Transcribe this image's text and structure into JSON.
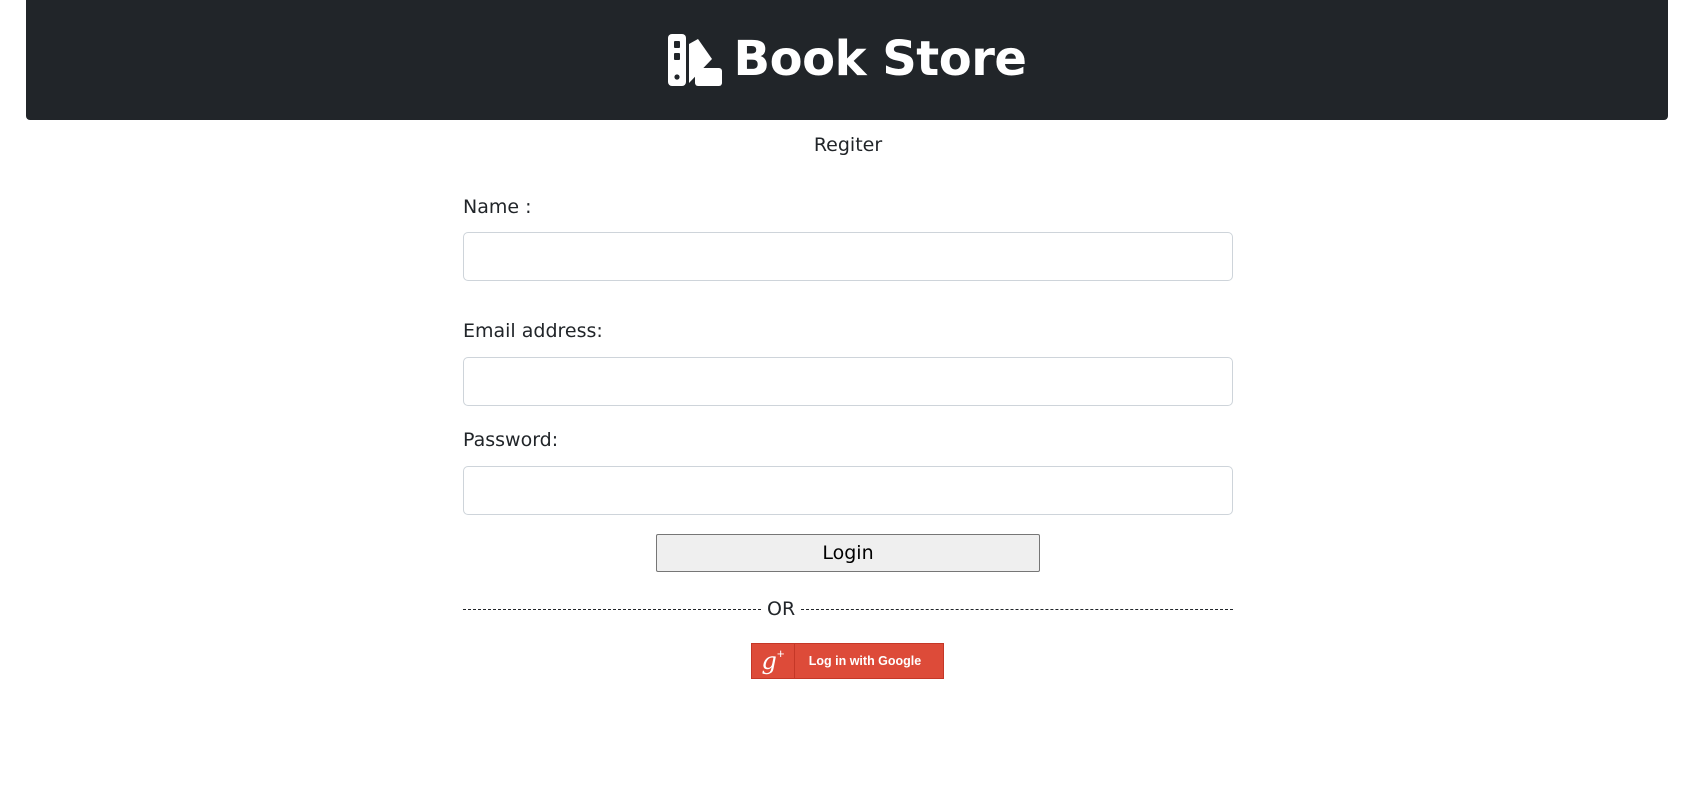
{
  "header": {
    "title": "Book Store",
    "icon": "books-icon",
    "background": "#212529"
  },
  "page": {
    "subtitle": "Regiter"
  },
  "form": {
    "name_label": "Name :",
    "name_value": "",
    "email_label": "Email address:",
    "email_value": "",
    "password_label": "Password:",
    "password_value": "",
    "submit_label": "Login",
    "separator_text": "OR"
  },
  "google": {
    "plus_glyph": "g",
    "plus_sign": "+",
    "label": "Log in with Google",
    "color": "#dd4b39"
  }
}
